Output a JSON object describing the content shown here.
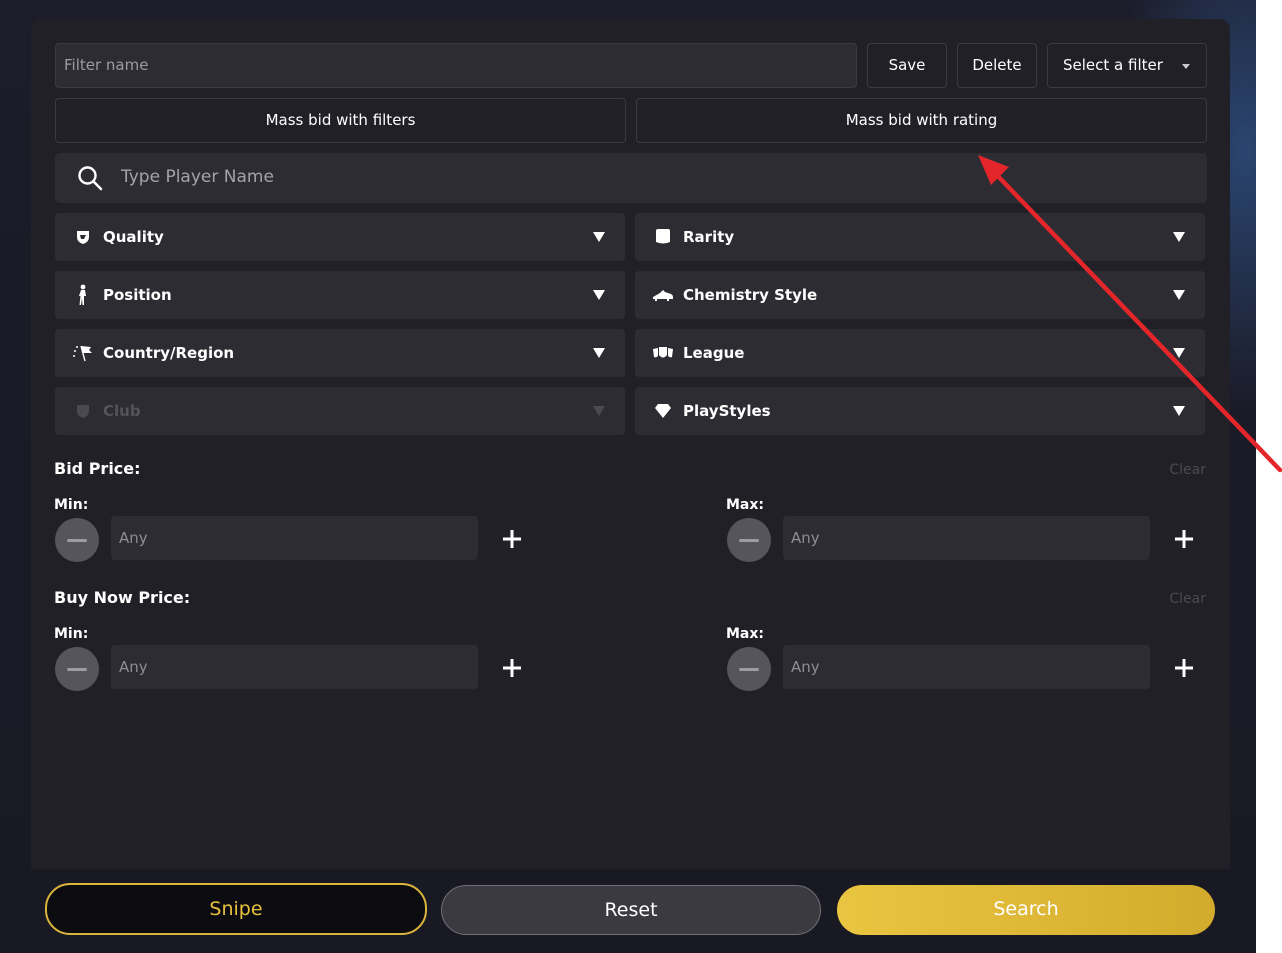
{
  "filter": {
    "name_placeholder": "Filter name",
    "save_label": "Save",
    "delete_label": "Delete",
    "select_label": "Select a filter"
  },
  "mass": {
    "filters_label": "Mass bid with filters",
    "rating_label": "Mass bid with rating"
  },
  "search": {
    "placeholder": "Type Player Name"
  },
  "dropdowns": {
    "quality": "Quality",
    "rarity": "Rarity",
    "position": "Position",
    "chemistry": "Chemistry Style",
    "country": "Country/Region",
    "league": "League",
    "club": "Club",
    "playstyles": "PlayStyles"
  },
  "bid": {
    "title": "Bid Price:",
    "clear": "Clear",
    "min_label": "Min:",
    "max_label": "Max:",
    "min_placeholder": "Any",
    "max_placeholder": "Any"
  },
  "buy_now": {
    "title": "Buy Now Price:",
    "clear": "Clear",
    "min_label": "Min:",
    "max_label": "Max:",
    "min_placeholder": "Any",
    "max_placeholder": "Any"
  },
  "actions": {
    "snipe": "Snipe",
    "reset": "Reset",
    "search": "Search"
  },
  "colors": {
    "accent_gold": "#e8c23c",
    "annotation_arrow": "#e4262b"
  }
}
